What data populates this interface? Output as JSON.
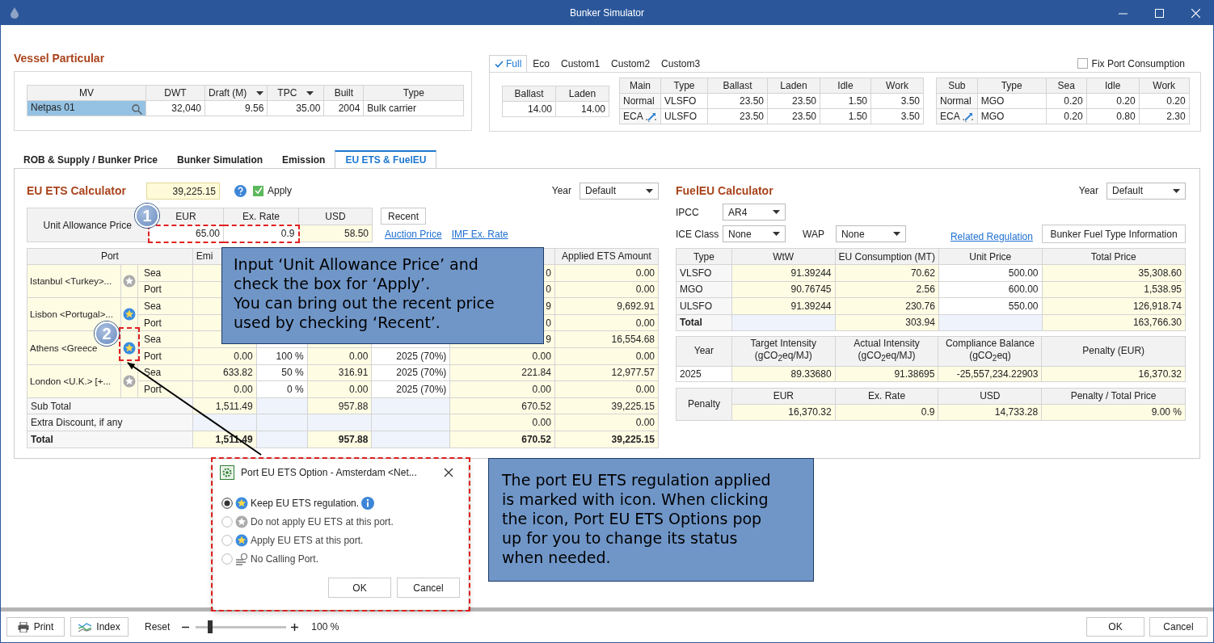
{
  "window": {
    "title": "Bunker Simulator"
  },
  "vessel": {
    "title": "Vessel Particular",
    "columns": [
      {
        "label": "MV",
        "dropdown": false
      },
      {
        "label": "DWT",
        "dropdown": false
      },
      {
        "label": "Draft (M)",
        "dropdown": true
      },
      {
        "label": "TPC",
        "dropdown": true
      },
      {
        "label": "Built",
        "dropdown": false
      },
      {
        "label": "Type",
        "dropdown": false
      }
    ],
    "row": {
      "mv": "Netpas 01",
      "values": [
        "32,040",
        "9.56",
        "35.00",
        "2004",
        "Bulk carrier"
      ]
    }
  },
  "consumption": {
    "modes": [
      {
        "label": "Full",
        "selected": true
      },
      {
        "label": "Eco",
        "selected": false
      },
      {
        "label": "Custom1",
        "selected": false
      },
      {
        "label": "Custom2",
        "selected": false
      },
      {
        "label": "Custom3",
        "selected": false
      }
    ],
    "fix_port": {
      "label": "Fix Port Consumption",
      "checked": false
    },
    "speed": {
      "columns": [
        "Ballast",
        "Laden"
      ],
      "values": [
        "14.00",
        "14.00"
      ]
    },
    "main": {
      "columns": [
        "Main",
        "Type",
        "Ballast",
        "Laden",
        "Idle",
        "Work"
      ],
      "rows": [
        {
          "mode": "Normal",
          "switch_icon": false,
          "values": [
            "VLSFO",
            "23.50",
            "23.50",
            "1.50",
            "3.50"
          ]
        },
        {
          "mode": "ECA",
          "switch_icon": true,
          "values": [
            "ULSFO",
            "23.50",
            "23.50",
            "1.50",
            "3.50"
          ]
        }
      ]
    },
    "sub": {
      "columns": [
        "Sub",
        "Type",
        "Sea",
        "Idle",
        "Work"
      ],
      "rows": [
        {
          "mode": "Normal",
          "switch_icon": false,
          "values": [
            "MGO",
            "0.20",
            "0.20",
            "0.20"
          ]
        },
        {
          "mode": "ECA",
          "switch_icon": true,
          "values": [
            "MGO",
            "0.20",
            "0.80",
            "2.30"
          ]
        }
      ]
    }
  },
  "tabs": [
    {
      "label": "ROB & Supply / Bunker Price",
      "selected": false
    },
    {
      "label": "Bunker Simulation",
      "selected": false
    },
    {
      "label": "Emission",
      "selected": false
    },
    {
      "label": "EU ETS & FuelEU",
      "selected": true
    }
  ],
  "ets": {
    "title": "EU ETS Calculator",
    "total": "39,225.15",
    "apply": {
      "label": "Apply",
      "checked": true
    },
    "year": {
      "label": "Year",
      "value": "Default"
    },
    "allowance": {
      "label": "Unit Allowance Price",
      "columns": [
        "EUR",
        "Ex. Rate",
        "USD"
      ],
      "values": [
        "65.00",
        "0.9",
        "58.50"
      ]
    },
    "recent": "Recent",
    "links": [
      "Auction Price",
      "IMF Ex. Rate"
    ],
    "table": {
      "port_header": "Port",
      "emission_header": "Emi",
      "applied_header": "Applied ETS Amount",
      "ports": [
        {
          "name": "Istanbul <Turkey>...",
          "ets_applied": false,
          "legs": [
            {
              "label": "Sea",
              "ets": "0",
              "applied": "0.00"
            },
            {
              "label": "Port",
              "ets": "0",
              "applied": "0.00"
            }
          ]
        },
        {
          "name": "Lisbon <Portugal>...",
          "ets_applied": true,
          "legs": [
            {
              "label": "Sea",
              "ets": "9",
              "applied": "9,692.91"
            },
            {
              "label": "Port",
              "ets": "0",
              "applied": "0.00"
            }
          ]
        },
        {
          "name": "Athens <Greece",
          "ets_applied": true,
          "legs": [
            {
              "label": "Sea",
              "ets": "9",
              "applied": "16,554.68"
            },
            {
              "label": "Port",
              "emission": "0.00",
              "share": "100 %",
              "amount": "0.00",
              "year": "2025 (70%)",
              "ets": "0.00",
              "applied": "0.00"
            }
          ]
        },
        {
          "name": "London <U.K.> [+...",
          "ets_applied": false,
          "legs": [
            {
              "label": "Sea",
              "emission": "633.82",
              "share": "50 %",
              "amount": "316.91",
              "year": "2025 (70%)",
              "ets": "221.84",
              "applied": "12,977.57"
            },
            {
              "label": "Port",
              "emission": "0.00",
              "share": "0 %",
              "amount": "0.00",
              "year": "2025 (70%)",
              "ets": "0.00",
              "applied": "0.00"
            }
          ]
        }
      ],
      "totals": [
        {
          "label": "Sub Total",
          "bold": false,
          "emission": "1,511.49",
          "amount": "957.88",
          "ets": "670.52",
          "applied": "39,225.15"
        },
        {
          "label": "Extra Discount, if any",
          "bold": false,
          "ets": "0.00",
          "applied": "0.00"
        },
        {
          "label": "Total",
          "bold": true,
          "emission": "1,511.49",
          "amount": "957.88",
          "ets": "670.52",
          "applied": "39,225.15"
        }
      ]
    }
  },
  "fueleu": {
    "title": "FuelEU Calculator",
    "year": {
      "label": "Year",
      "value": "Default"
    },
    "ipcc": {
      "label": "IPCC",
      "value": "AR4"
    },
    "ice": {
      "label": "ICE Class",
      "value": "None"
    },
    "wap": {
      "label": "WAP",
      "value": "None"
    },
    "link": "Related Regulation",
    "info_button": "Bunker Fuel Type Information",
    "fuel_table": {
      "columns": [
        "Type",
        "WtW",
        "EU Consumption (MT)",
        "Unit Price",
        "Total Price"
      ],
      "rows": [
        {
          "type": "VLSFO",
          "values": [
            "91.39244",
            "70.62",
            "500.00",
            "35,308.60"
          ]
        },
        {
          "type": "MGO",
          "values": [
            "90.76745",
            "2.56",
            "600.00",
            "1,538.95"
          ]
        },
        {
          "type": "ULSFO",
          "values": [
            "91.39244",
            "230.76",
            "550.00",
            "126,918.74"
          ]
        }
      ],
      "total": {
        "label": "Total",
        "consumption": "303.94",
        "total_price": "163,766.30"
      }
    },
    "intensity": {
      "columns": [
        {
          "label": "Year"
        },
        {
          "label": "Target Intensity",
          "unit": "(gCO$_{2}$eq/MJ)"
        },
        {
          "label": "Actual Intensity",
          "unit": "(gCO$_{2}$eq/MJ)"
        },
        {
          "label": "Compliance Balance",
          "unit": "(gCO$_{2}$eq)"
        },
        {
          "label": "Penalty (EUR)"
        }
      ],
      "values": [
        "2025",
        "89.33680",
        "91.38695",
        "-25,557,234.22903",
        "16,370.32"
      ]
    },
    "penalty": {
      "label": "Penalty",
      "columns": [
        "EUR",
        "Ex. Rate",
        "USD",
        "Penalty / Total Price"
      ],
      "values": [
        "16,370.32",
        "0.9",
        "14,733.28",
        "9.00 %"
      ]
    }
  },
  "callouts": [
    {
      "text": "Input ‘Unit Allowance Price’ and check the box for ‘Apply’.\nYou can bring out the recent price used by checking ‘Recent’."
    },
    {
      "text": "The port EU ETS regulation applied is marked with icon. When clicking the icon, Port EU ETS Options pop up for you to change its status when needed."
    }
  ],
  "markers": [
    "1",
    "2"
  ],
  "popup": {
    "title": "Port EU ETS Option - Amsterdam <Net...",
    "options": [
      {
        "label": "Keep EU ETS regulation.",
        "selected": true,
        "kind": "apply",
        "info": true
      },
      {
        "label": "Do not apply EU ETS at this port.",
        "selected": false,
        "kind": "exclude",
        "info": false
      },
      {
        "label": "Apply EU ETS at this port.",
        "selected": false,
        "kind": "apply",
        "info": false
      },
      {
        "label": "No Calling Port.",
        "selected": false,
        "kind": "skip",
        "info": false
      }
    ],
    "buttons": [
      "OK",
      "Cancel"
    ]
  },
  "footer": {
    "print": "Print",
    "index": "Index",
    "reset": "Reset",
    "zoom": {
      "level": 0.16,
      "reading": "100 %"
    },
    "buttons": [
      "OK",
      "Cancel"
    ]
  }
}
